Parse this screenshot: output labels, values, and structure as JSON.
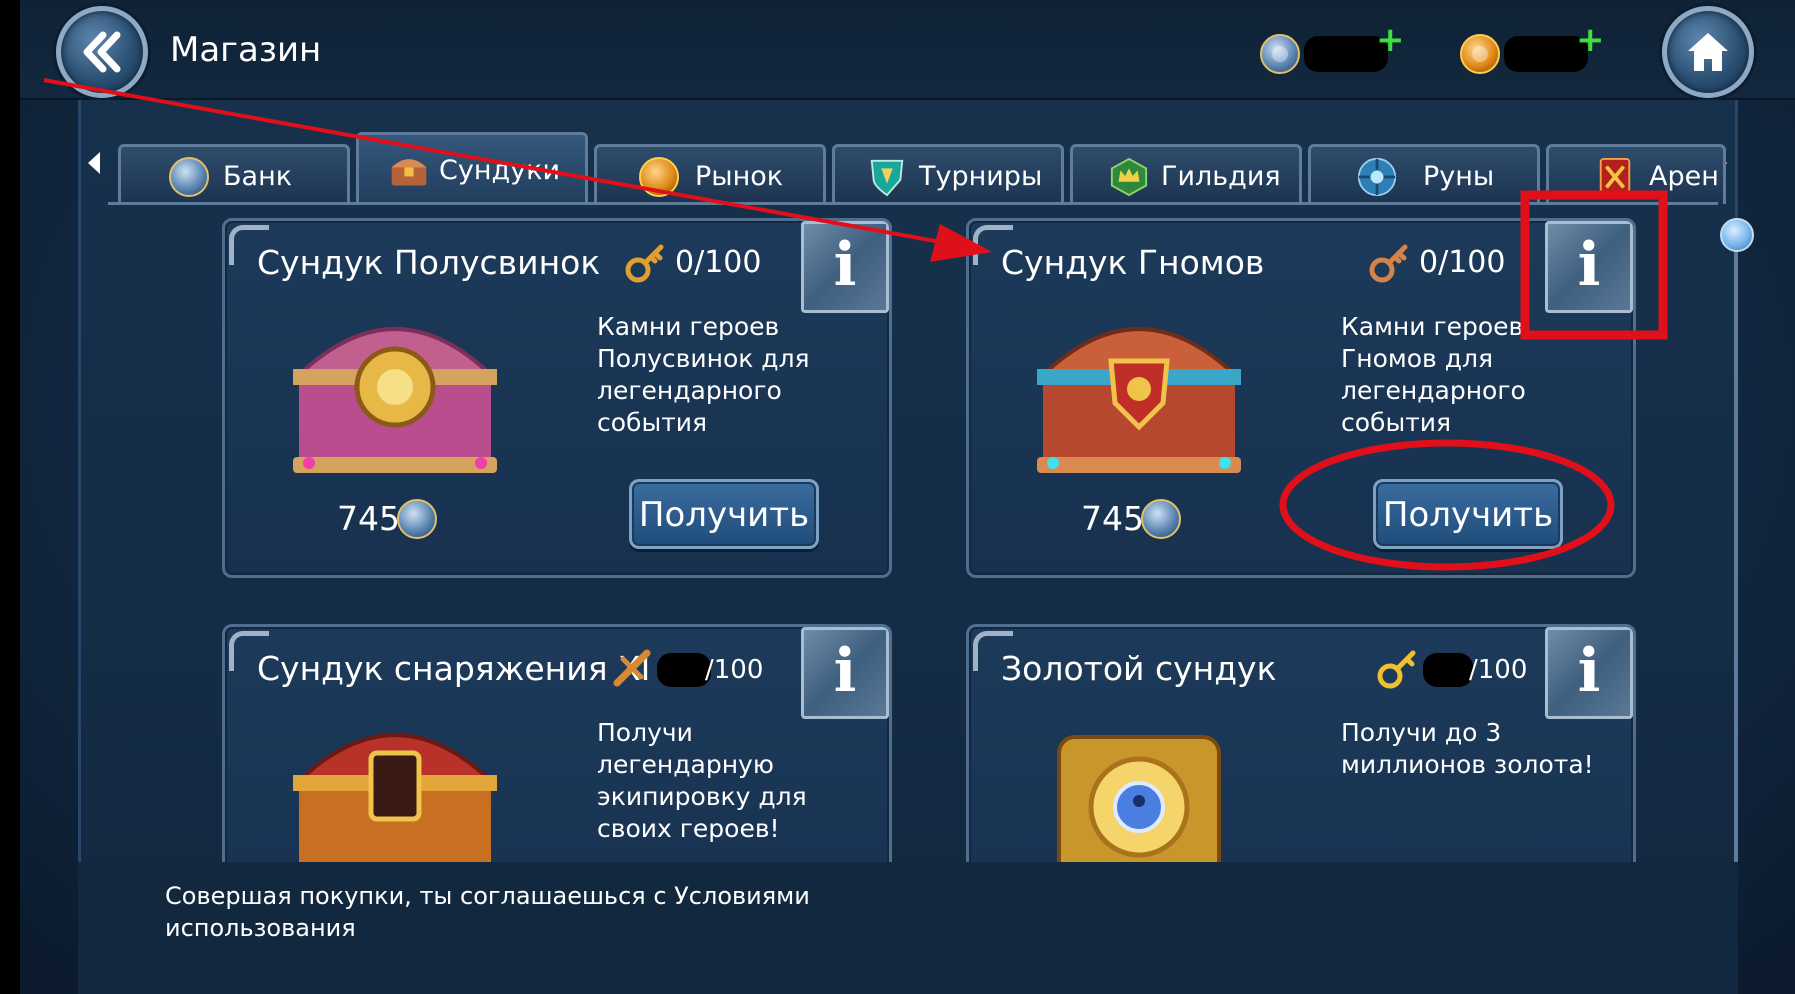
{
  "header": {
    "title": "Магазин",
    "currencies": [
      {
        "icon": "gem-coin-icon",
        "value": "",
        "plus": "+"
      },
      {
        "icon": "gold-coin-icon",
        "value": "",
        "plus": "+"
      }
    ]
  },
  "tabs": [
    {
      "label": "Банк",
      "icon": "bank-coin-icon"
    },
    {
      "label": "Сундуки",
      "icon": "chest-icon",
      "active": true
    },
    {
      "label": "Рынок",
      "icon": "market-icon"
    },
    {
      "label": "Турниры",
      "icon": "tournament-shield-icon"
    },
    {
      "label": "Гильдия",
      "icon": "guild-crown-icon"
    },
    {
      "label": "Руны",
      "icon": "rune-icon"
    },
    {
      "label": "Арен",
      "icon": "arena-icon"
    }
  ],
  "cards": [
    {
      "title": "Сундук Полусвинок",
      "progress": "0/100",
      "description": [
        "Камни героев",
        "Полусвинок для",
        "легендарного",
        "события"
      ],
      "price": "745",
      "button": "Получить",
      "info": "i"
    },
    {
      "title": "Сундук Гномов",
      "progress": "0/100",
      "description": [
        "Камни героев",
        "Гномов для",
        "легендарного",
        "события"
      ],
      "price": "745",
      "button": "Получить",
      "info": "i"
    },
    {
      "title": "Сундук снаряжения XI",
      "progress": "/100",
      "description": [
        "Получи",
        "легендарную",
        "экипировку для",
        "своих героев!"
      ],
      "info": "i"
    },
    {
      "title": "Золотой сундук",
      "progress": "/100",
      "description": [
        "Получи до 3",
        "миллионов золота!"
      ],
      "info": "i"
    }
  ],
  "footer": {
    "line1": "Совершая покупки, ты соглашаешься с Условиями",
    "line2": "использования"
  },
  "colors": {
    "annotation": "#e0101a",
    "background": "#132b45",
    "button": "#2a5b8c",
    "plus": "#3ee03e"
  }
}
